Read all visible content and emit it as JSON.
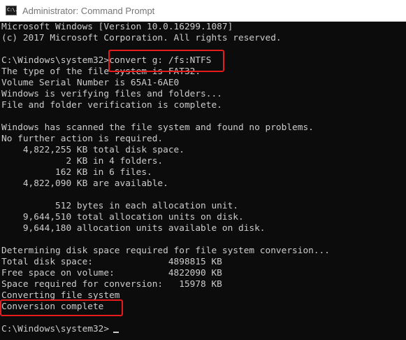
{
  "window": {
    "title": "Administrator: Command Prompt",
    "icon_label": "C:\\."
  },
  "console": {
    "lines": [
      "Microsoft Windows [Version 10.0.16299.1087]",
      "(c) 2017 Microsoft Corporation. All rights reserved.",
      "",
      "C:\\Windows\\system32>convert g: /fs:NTFS",
      "The type of the file system is FAT32.",
      "Volume Serial Number is 65A1-6AE0",
      "Windows is verifying files and folders...",
      "File and folder verification is complete.",
      "",
      "Windows has scanned the file system and found no problems.",
      "No further action is required.",
      "    4,822,255 KB total disk space.",
      "            2 KB in 4 folders.",
      "          162 KB in 6 files.",
      "    4,822,090 KB are available.",
      "",
      "          512 bytes in each allocation unit.",
      "    9,644,510 total allocation units on disk.",
      "    9,644,180 allocation units available on disk.",
      "",
      "Determining disk space required for file system conversion...",
      "Total disk space:              4898815 KB",
      "Free space on volume:          4822090 KB",
      "Space required for conversion:   15978 KB",
      "Converting file system",
      "Conversion complete",
      "",
      "C:\\Windows\\system32>"
    ]
  },
  "colors": {
    "console_background": "#0c0c0c",
    "console_text": "#cccccc",
    "highlight_border": "#e61c1c",
    "titlebar_background": "#ffffff",
    "title_text": "#767676"
  }
}
